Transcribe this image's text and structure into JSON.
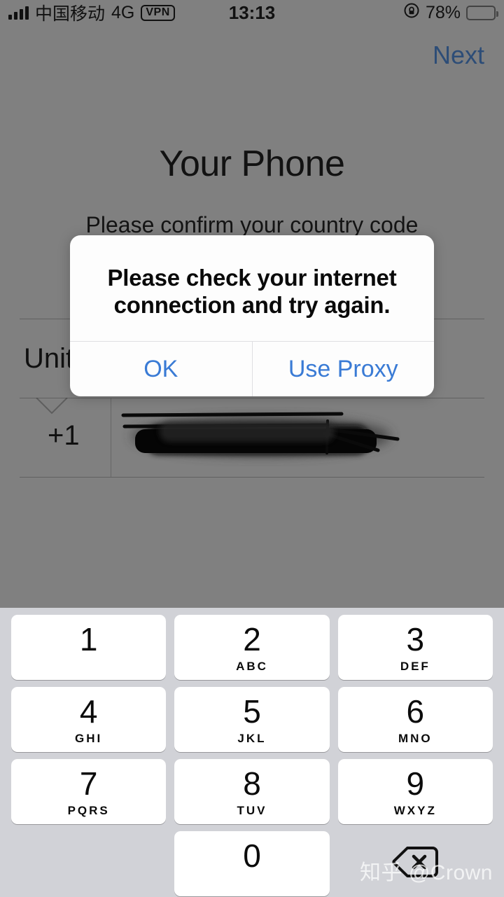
{
  "status_bar": {
    "carrier": "中国移动",
    "network": "4G",
    "vpn_badge": "VPN",
    "time": "13:13",
    "battery_percent": "78%",
    "signal_icon": "signal-bars-icon",
    "rotation_lock_icon": "rotation-lock-icon",
    "battery_icon": "battery-icon"
  },
  "nav": {
    "next_label": "Next"
  },
  "page": {
    "title": "Your Phone",
    "subtitle": "Please confirm your country code"
  },
  "form": {
    "country_name": "United States",
    "country_name_visible": "Unit",
    "dial_code": "+1",
    "phone_number": "",
    "phone_number_state": "redacted",
    "chevron_icon": "chevron-down-icon"
  },
  "alert": {
    "message": "Please check your internet connection and try again.",
    "buttons": [
      {
        "label": "OK"
      },
      {
        "label": "Use Proxy"
      }
    ]
  },
  "keypad": {
    "keys": [
      {
        "digit": "1",
        "letters": ""
      },
      {
        "digit": "2",
        "letters": "ABC"
      },
      {
        "digit": "3",
        "letters": "DEF"
      },
      {
        "digit": "4",
        "letters": "GHI"
      },
      {
        "digit": "5",
        "letters": "JKL"
      },
      {
        "digit": "6",
        "letters": "MNO"
      },
      {
        "digit": "7",
        "letters": "PQRS"
      },
      {
        "digit": "8",
        "letters": "TUV"
      },
      {
        "digit": "9",
        "letters": "WXYZ"
      },
      {
        "digit": "0",
        "letters": ""
      }
    ],
    "backspace_icon": "backspace-icon"
  },
  "watermark": {
    "text": "知乎 @Crown"
  },
  "colors": {
    "overlay_dim": "#808080",
    "alert_accent": "#3a7bd5",
    "next_dimmed": "#2d4d77",
    "keyboard_bg": "#d1d2d7",
    "key_bg": "#ffffff"
  }
}
